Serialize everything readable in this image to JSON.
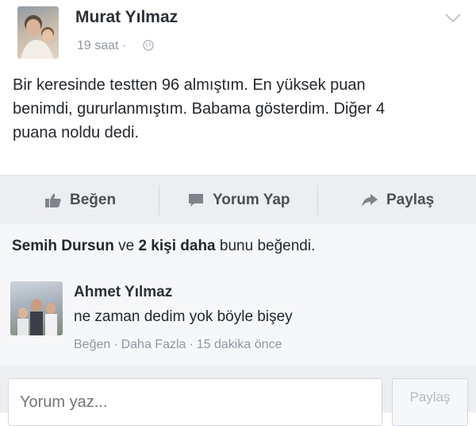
{
  "post": {
    "author": "Murat Yılmaz",
    "time": "19 saat",
    "time_separator": "·",
    "body_line1": "Bir keresinde testten 96 almıştım. En yüksek puan",
    "body_line2": "benimdi, gururlanmıştım. Babama gösterdim. Diğer 4",
    "body_line3": "puana noldu dedi."
  },
  "actions": {
    "like": "Beğen",
    "comment": "Yorum Yap",
    "share": "Paylaş"
  },
  "likes": {
    "name": "Semih Dursun",
    "connector": "ve",
    "others": "2 kişi daha",
    "suffix": "bunu beğendi."
  },
  "comment": {
    "author": "Ahmet Yılmaz",
    "text": "ne zaman dedim yok böyle bişey",
    "like": "Beğen",
    "more": "Daha Fazla",
    "time": "15 dakika önce",
    "separator": "·"
  },
  "composer": {
    "placeholder": "Yorum yaz...",
    "share": "Paylaş"
  },
  "icons": {
    "privacy": "globe-icon",
    "menu": "chevron-down-icon",
    "like": "thumbs-up-icon",
    "comment": "speech-bubble-icon",
    "share": "share-arrow-icon"
  }
}
